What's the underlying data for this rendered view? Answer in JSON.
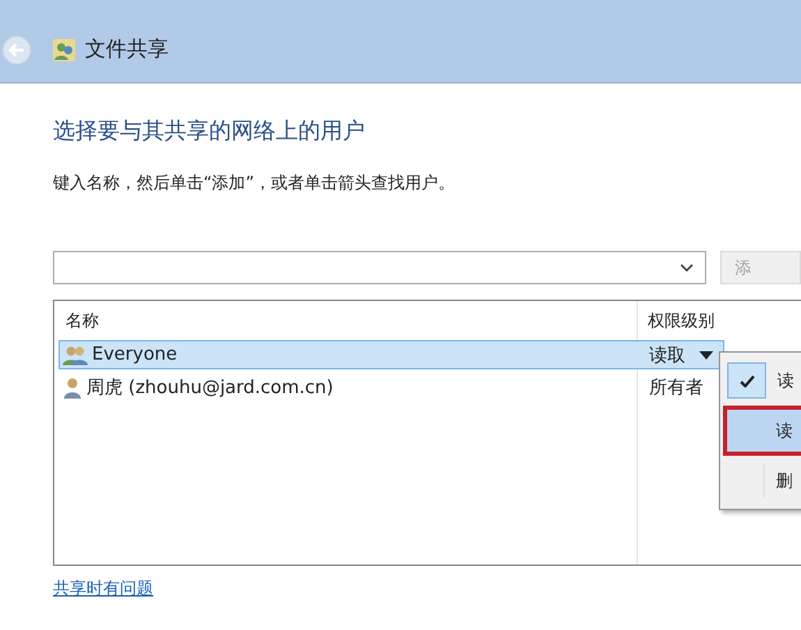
{
  "window": {
    "title": "文件共享"
  },
  "heading": "选择要与其共享的网络上的用户",
  "instruction": "键入名称，然后单击“添加”，或者单击箭头查找用户。",
  "add_button": "添",
  "table": {
    "columns": [
      "名称",
      "权限级别"
    ],
    "rows": [
      {
        "kind": "group",
        "name": "Everyone",
        "permission": "读取",
        "selected": true,
        "dropdown": true
      },
      {
        "kind": "user",
        "name": "周虎 (zhouhu@jard.com.cn)",
        "permission": "所有者",
        "selected": false,
        "dropdown": false
      }
    ]
  },
  "menu": [
    {
      "label": "读",
      "checked": true,
      "selected": false
    },
    {
      "label": "读",
      "checked": false,
      "selected": true
    },
    {
      "label": "删",
      "checked": false,
      "selected": false
    }
  ],
  "help_link": "共享时有问题"
}
